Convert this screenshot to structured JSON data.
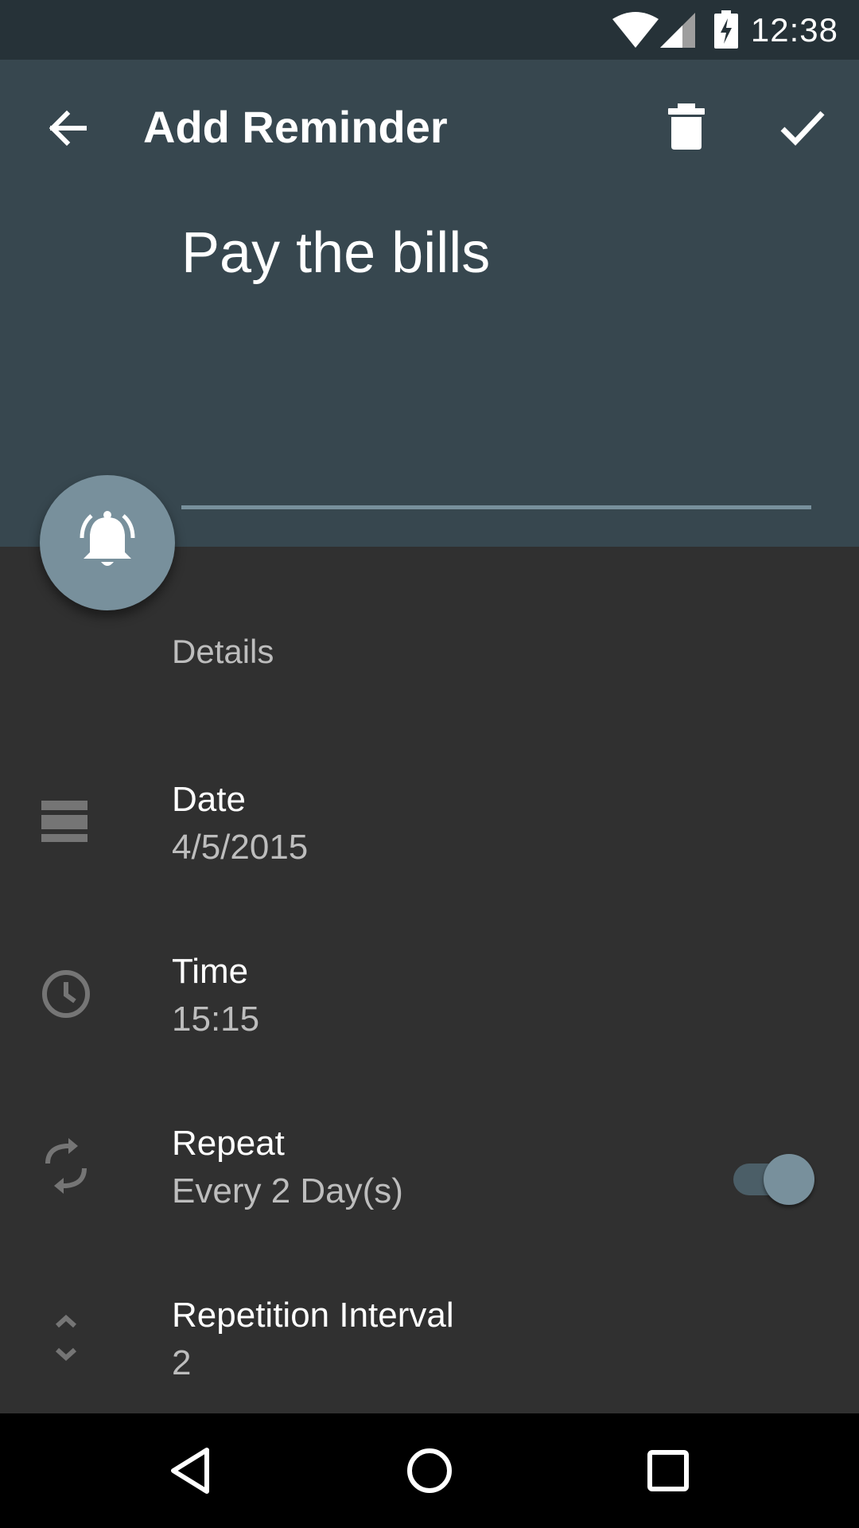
{
  "status_bar": {
    "time": "12:38",
    "icons": [
      "wifi-icon",
      "cell-signal-icon",
      "battery-charging-icon"
    ]
  },
  "toolbar": {
    "title": "Add Reminder",
    "back_icon": "arrow-back-icon",
    "delete_icon": "trash-icon",
    "save_icon": "check-icon"
  },
  "reminder": {
    "title": "Pay the bills"
  },
  "fab": {
    "icon": "bell-ringing-icon"
  },
  "details": {
    "section_label": "Details",
    "rows": [
      {
        "label": "Date",
        "value": "4/5/2015",
        "icon": "calendar-icon"
      },
      {
        "label": "Time",
        "value": "15:15",
        "icon": "clock-icon"
      },
      {
        "label": "Repeat",
        "value": "Every 2 Day(s)",
        "icon": "repeat-icon",
        "switch_on": true
      },
      {
        "label": "Repetition Interval",
        "value": "2",
        "icon": "unfold-icon"
      }
    ]
  },
  "nav_bar": {
    "icons": [
      "back-triangle-icon",
      "home-circle-icon",
      "recents-square-icon"
    ]
  },
  "colors": {
    "status_bar": "#263238",
    "header": "#37474f",
    "accent": "#78909c",
    "background": "#303030",
    "secondary_text": "#bdbdbd"
  }
}
